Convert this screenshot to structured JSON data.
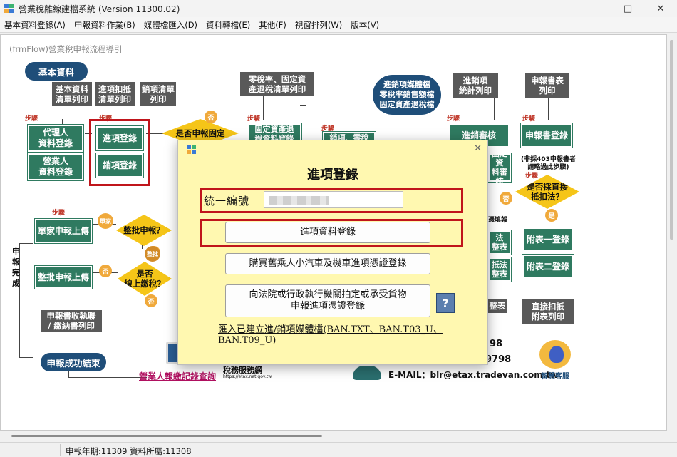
{
  "window": {
    "title": "營業稅離線建檔系統 (Version 11300.02)"
  },
  "menu": [
    "基本資料登錄(A)",
    "申報資料作業(B)",
    "媒體檔匯入(D)",
    "資料轉檔(E)",
    "其他(F)",
    "視窗排列(W)",
    "版本(V)"
  ],
  "panel": {
    "title": "(frmFlow)營業稅申報流程導引"
  },
  "flow": {
    "basic_pill": "基本資料",
    "success_pill": "申報成功結束",
    "media_pill": "進銷項媒體檔\n零稅率銷售額檔\n固定資產退稅檔",
    "boxes": {
      "agent": "代理人\n資料登錄",
      "business": "營業人\n資料登錄",
      "purchase": "進項登錄",
      "sales": "銷項登錄",
      "fixed_asset": "固定資產退\n稅資料登錄",
      "sales_zero": "銷項、零稅",
      "sales_review": "進銷審核",
      "declare": "申報書登錄",
      "single_upload": "單家申報上傳",
      "batch_upload": "整批申報上傳",
      "att1": "附表一登錄",
      "att2": "附表二登錄",
      "fixed_review": "固定資\n料審核",
      "law1": "法\n整表",
      "law2": "抵法\n整表"
    },
    "docs": {
      "basic_list": "基本資料\n清單列印",
      "purchase_list": "進項扣抵\n清單列印",
      "sales_list": "銷項清單\n列印",
      "zero_tax": "零稅率、固定資\n產退稅清單列印",
      "stats": "進銷項\n統計列印",
      "form_print": "申報書表\n列印",
      "receipt": "申報書收執聯\n/ 繳納書列印",
      "deduct_print": "直接扣抵\n附表列印",
      "law3": "整表"
    },
    "diamonds": {
      "fixed_q": "是否申報固定",
      "batch_q": "整批申報？",
      "online_q": "是否\n線上繳稅？",
      "direct_q": "是否採直接\n抵扣法？"
    },
    "steps": {
      "s1": "步驟",
      "s2": "步驟",
      "s3": "步驟",
      "s4": "步驟",
      "s5": "步驟",
      "s7": "步驟",
      "s8": "步驟",
      "s13": "步驟"
    },
    "badges": {
      "no1": "否",
      "no2": "否",
      "no3": "否",
      "no4": "否",
      "yes1": "是",
      "yes2": "是",
      "single": "單家",
      "batch": "整批"
    },
    "notes": {
      "declare_note": "(非採403申報書者\n請略過此步驟)",
      "report_note": "憑填報",
      "vertical": "申\n報\n完\n成",
      "query_link": "營業人報繳記錄查詢",
      "tax_net": "稅務服務網",
      "tax_url": "https://etax.nat.gov.tw",
      "phone1": "98",
      "phone2": "9798",
      "email": "E-MAIL：blr@etax.tradevan.com.tw",
      "service": "智慧客服"
    }
  },
  "modal": {
    "title": "進項登錄",
    "ubn_label": "統一編號",
    "btn_entry": "進項資料登錄",
    "btn_car": "購買舊乘人小汽車及機車進項憑證登錄",
    "btn_court": "向法院或行政執行機關拍定或承受貨物\n申報進項憑證登錄",
    "link_import": "匯入已建立進/銷項媒體檔(BAN.TXT、BAN.T03_U、BAN.T09_U)"
  },
  "status": {
    "text": "申報年期:11309 資料所屬:11308"
  }
}
